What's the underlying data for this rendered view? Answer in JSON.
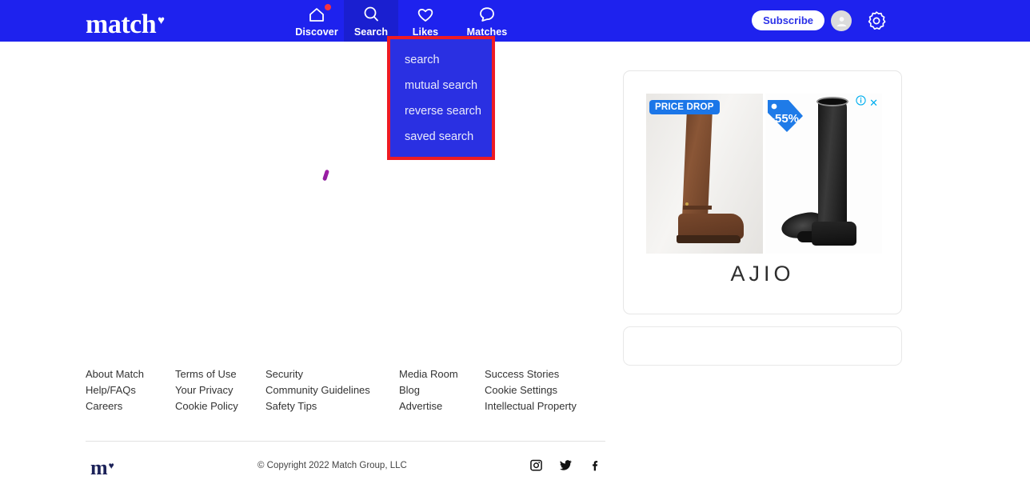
{
  "header": {
    "logo_text": "match",
    "logo_heart": "♥",
    "nav": [
      {
        "label": "Discover",
        "icon": "home-icon",
        "active": false,
        "badge": true
      },
      {
        "label": "Search",
        "icon": "search-icon",
        "active": true,
        "badge": false
      },
      {
        "label": "Likes",
        "icon": "heart-icon",
        "active": false,
        "badge": false
      },
      {
        "label": "Matches",
        "icon": "chat-bubble-icon",
        "active": false,
        "badge": false
      }
    ],
    "subscribe_label": "Subscribe",
    "avatar_icon": "user-avatar-icon",
    "settings_icon": "gear-icon",
    "brand_blue": "#1E22EE",
    "active_tab_blue": "#1A1FD0",
    "badge_red": "#F5333F"
  },
  "search_dropdown": {
    "highlight_color": "#EE1B24",
    "background": "#2A30E2",
    "items": [
      {
        "label": "search"
      },
      {
        "label": "mutual search"
      },
      {
        "label": "reverse search"
      },
      {
        "label": "saved search"
      }
    ]
  },
  "ad": {
    "price_drop_label": "PRICE DROP",
    "discount_label": "-55%",
    "brand": "AJIO",
    "adchoices_icon": "info-adchoices-icon",
    "close_icon": "close-icon",
    "badge_blue": "#1B76E8",
    "control_color": "#00AEEF",
    "left_image_alt": "brown-knee-high-boot",
    "right_image_alt": "black-knee-high-boot"
  },
  "footer": {
    "columns": [
      {
        "links": [
          "About Match",
          "Help/FAQs",
          "Careers"
        ]
      },
      {
        "links": [
          "Terms of Use",
          "Your Privacy",
          "Cookie Policy"
        ]
      },
      {
        "links": [
          "Security",
          "Community Guidelines",
          "Safety Tips"
        ]
      },
      {
        "links": [
          "Media Room",
          "Blog",
          "Advertise"
        ]
      },
      {
        "links": [
          "Success Stories",
          "Cookie Settings",
          "Intellectual Property"
        ]
      }
    ],
    "logo_text": "m",
    "logo_heart": "♥",
    "copyright": "© Copyright 2022 Match Group, LLC",
    "socials": [
      {
        "name": "instagram-icon"
      },
      {
        "name": "twitter-icon"
      },
      {
        "name": "facebook-icon"
      }
    ]
  }
}
